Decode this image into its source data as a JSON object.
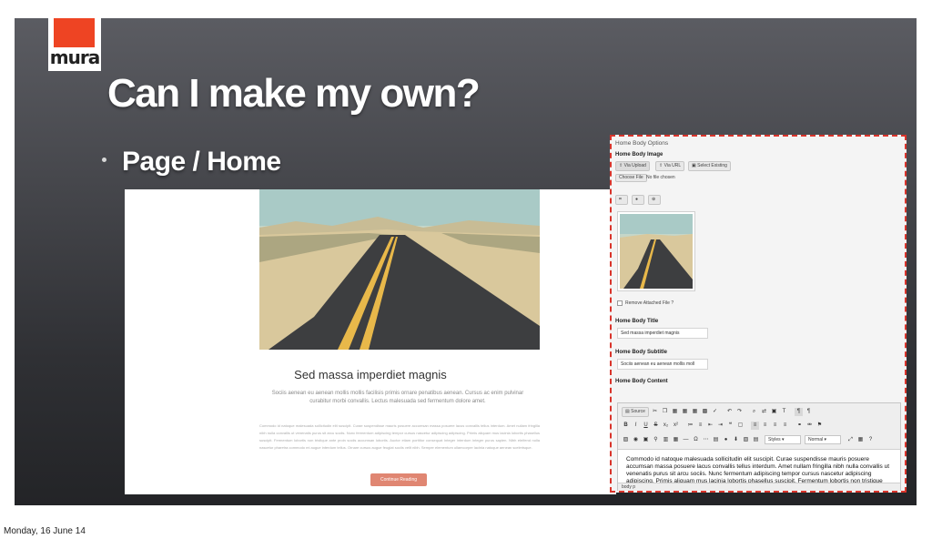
{
  "slide": {
    "logo": "mura",
    "title": "Can I make my own?",
    "bullet": "Page / Home"
  },
  "preview": {
    "heading": "Sed massa imperdiet magnis",
    "subtext": "Sociis aenean eu aenean mollis mollis facilisis primis ornare penatibus aenean. Cursus ac enim pulvinar curabitur morbi convallis. Lectus malesuada sed fermentum dolore amet.",
    "body": "Commodo id natoque malesuada sollicitudin elit suscipit. Curae suspendisse mauris posuere accumsan massa posuere lacus convallis tellus interdum. Amet nullam fringilla nibh nulla convallis ut venenatis purus sit arcu sociis. Nunc fermentum adipiscing tempor cursus nascetur adipiscing adipiscing. Primis aliquam mus lacinia lobortis phasellus suscipit. Fermentum lobortis non tristique ante proin sociis accumsan lobortis. Auctor etiam porttitor consequat integer interdum integer purus sapien. Nibh eleifend nulla nascetur pharetra commodo mi augue interdum tellus. Ornare cursus augue feugiat sociis velit nibh. Semper elementum ullamcorper lacinia natoque aenean scelerisque.",
    "button": "Continue Reading"
  },
  "panel": {
    "title": "Home Body Options",
    "image_label": "Home Body Image",
    "tabs": [
      "Via Upload",
      "Via URL",
      "Select Existing"
    ],
    "choose_file": "Choose File",
    "no_file": "No file chosen",
    "remove_label": "Remove Attached File",
    "title_label": "Home Body Title",
    "title_value": "Sed massa imperdiet magnis",
    "subtitle_label": "Home Body Subtitle",
    "subtitle_value": "Sociis aenean eu aenean mollis moll",
    "content_label": "Home Body Content",
    "source_button": "Source",
    "styles_select": "Styles",
    "format_select": "Normal",
    "content_text": "Commodo id natoque malesuada sollicitudin elit suscipit. Curae suspendisse mauris posuere accumsan massa posuere lacus convallis tellus interdum. Amet nullam fringilla nibh nulla convallis ut venenatis purus sit arcu sociis. Nunc fermentum adipiscing tempor cursus nascetur adipiscing adipiscing. Primis aliquam mus lacinia lobortis phasellus suscipit. Fermentum lobortis non tristique ante proin sociis accumsan lobortis. Auctor etiam",
    "status_path": "body  p"
  },
  "footer": {
    "date": "Monday, 16 June 14"
  }
}
